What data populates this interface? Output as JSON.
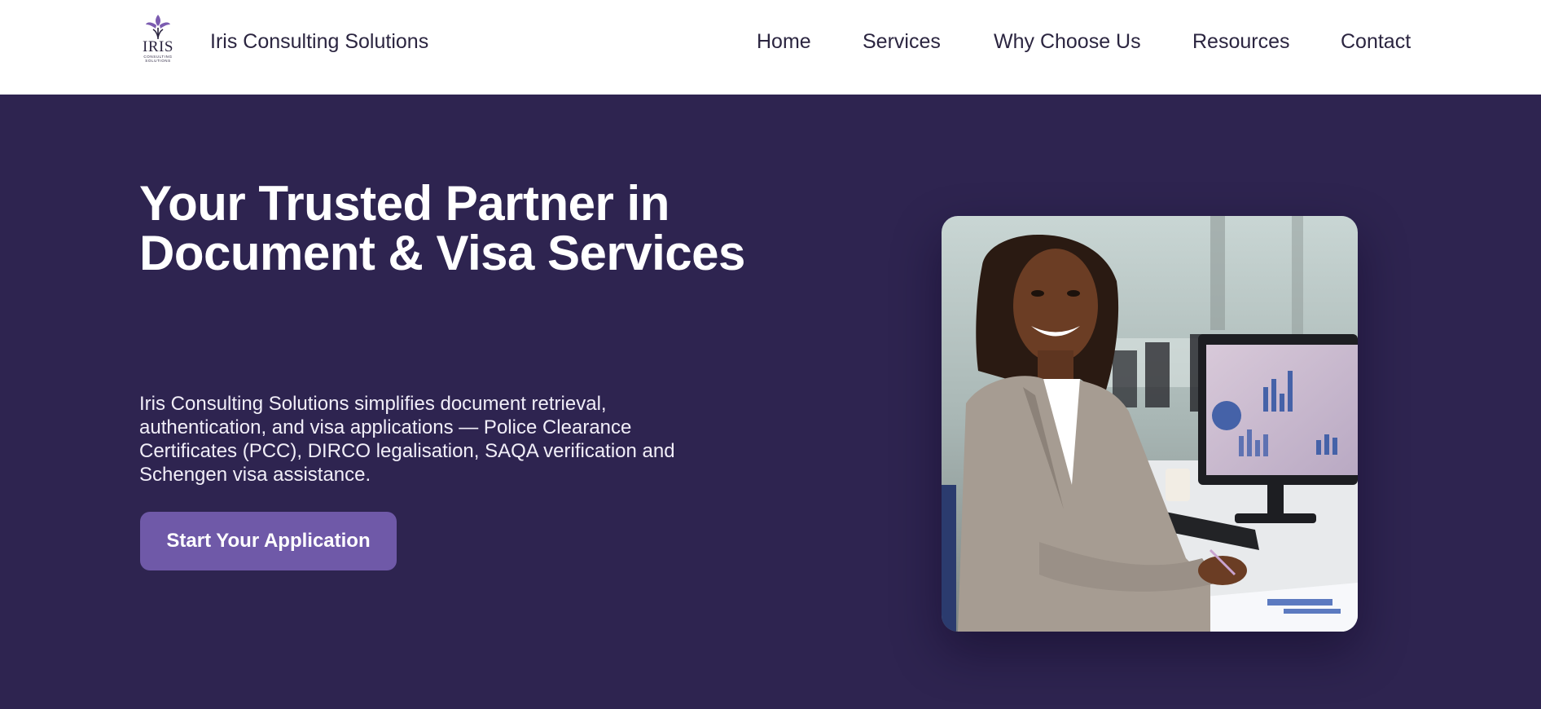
{
  "brand": {
    "logo_word": "IRIS",
    "logo_sub_1": "CONSULTING",
    "logo_sub_2": "SOLUTIONS",
    "name": "Iris Consulting Solutions"
  },
  "nav": {
    "items": [
      {
        "label": "Home"
      },
      {
        "label": "Services"
      },
      {
        "label": "Why Choose Us"
      },
      {
        "label": "Resources"
      },
      {
        "label": "Contact"
      }
    ]
  },
  "hero": {
    "headline_line1": "Your Trusted Partner in",
    "headline_line2": "Document & Visa Services",
    "lead": "Iris Consulting Solutions simplifies document retrieval, authentication, and visa applications — Police Clearance Certificates (PCC), DIRCO legalisation, SAQA verification and Schengen visa assistance.",
    "cta_label": "Start Your Application"
  },
  "colors": {
    "hero_background": "#2e2450",
    "cta_background": "#6f59a8",
    "logo_purple": "#7b5bb0",
    "nav_text": "#2b2540"
  },
  "icons": {
    "logo": "iris-flower-icon"
  }
}
